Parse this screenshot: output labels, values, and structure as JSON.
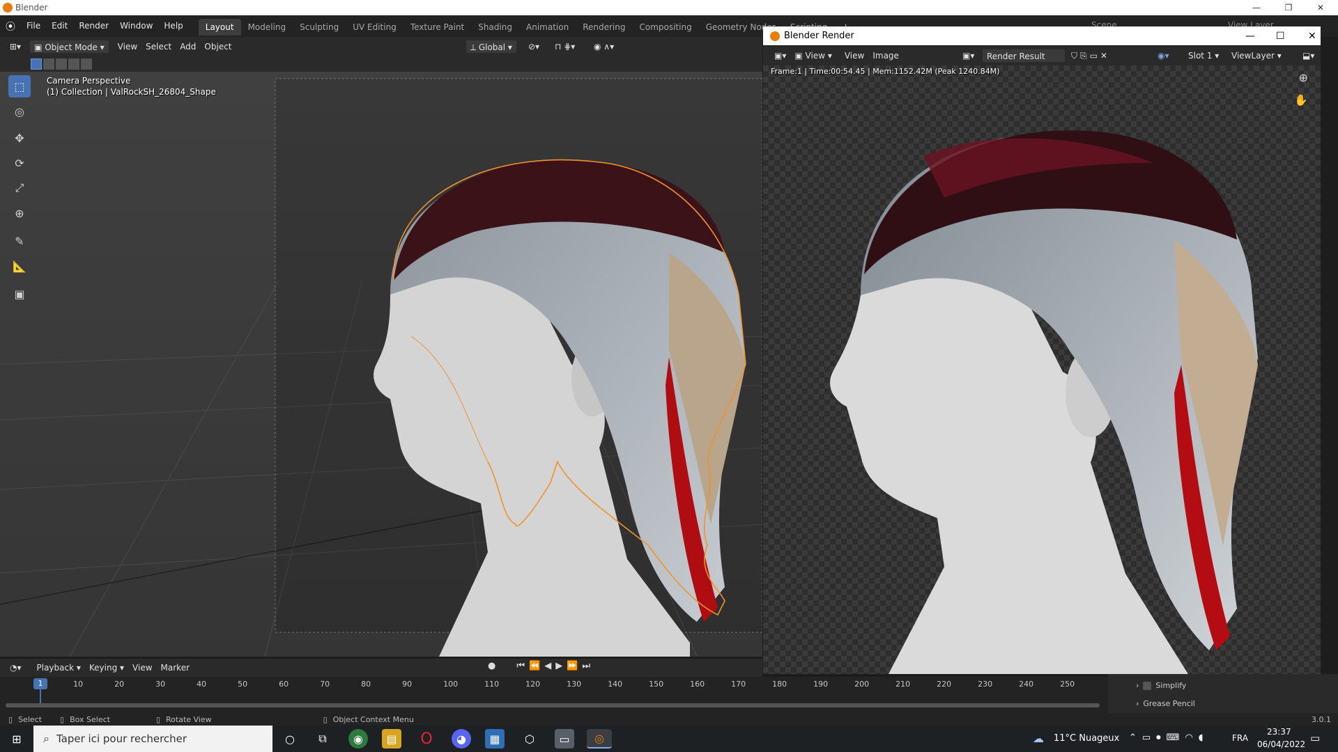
{
  "os": {
    "title": "Blender",
    "minimize": "—",
    "restore": "❐",
    "close": "✕"
  },
  "menu": [
    "File",
    "Edit",
    "Render",
    "Window",
    "Help"
  ],
  "workspaces": [
    "Layout",
    "Modeling",
    "Sculpting",
    "UV Editing",
    "Texture Paint",
    "Shading",
    "Animation",
    "Rendering",
    "Compositing",
    "Geometry Nodes",
    "Scripting"
  ],
  "workspace_add": "+",
  "scene_field": "Scene",
  "viewlayer_field": "View Layer",
  "viewport_header": {
    "mode": "Object Mode",
    "view": "View",
    "select": "Select",
    "add": "Add",
    "object": "Object",
    "orientation": "Global"
  },
  "viewport": {
    "camera_label": "Camera Perspective",
    "collection_label": "(1) Collection | ValRockSH_26804_Shape"
  },
  "timeline": {
    "playback": "Playback",
    "keying": "Keying",
    "view": "View",
    "marker": "Marker",
    "current_frame": "1",
    "ticks": [
      "10",
      "20",
      "30",
      "40",
      "50",
      "60",
      "70",
      "80",
      "90",
      "100",
      "110",
      "120",
      "130",
      "140",
      "150",
      "160",
      "170",
      "180",
      "190",
      "200",
      "210",
      "220",
      "230",
      "240",
      "250"
    ]
  },
  "status_bar": {
    "select": "Select",
    "box_select": "Box Select",
    "rotate_view": "Rotate View",
    "context_menu": "Object Context Menu",
    "version": "3.0.1"
  },
  "render_window": {
    "title": "Blender Render",
    "view": "View",
    "view2": "View",
    "image": "Image",
    "render_result": "Render Result",
    "slot": "Slot 1",
    "viewlayer": "ViewLayer",
    "frame_info": "Frame:1 | Time:00:54.45 | Mem:1152.42M (Peak 1240.84M)"
  },
  "properties": {
    "simplify": "Simplify",
    "grease_pencil": "Grease Pencil"
  },
  "taskbar": {
    "search_placeholder": "Taper ici pour rechercher",
    "weather": "11°C  Nuageux",
    "language": "FRA",
    "time": "23:37",
    "date": "06/04/2022"
  },
  "colors": {
    "accent": "#4772b3",
    "selection_outline": "#f2922b",
    "blender_orange": "#e87d0d"
  }
}
